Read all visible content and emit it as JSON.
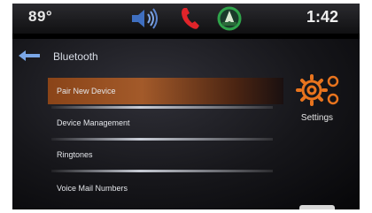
{
  "status": {
    "temperature": "89°",
    "time": "1:42"
  },
  "icons": {
    "audio": "speaker-icon",
    "phone": "phone-icon",
    "nav": "navigation-icon",
    "back": "back-arrow-icon",
    "settings": "gear-icon"
  },
  "header": {
    "title": "Bluetooth"
  },
  "menu": [
    {
      "label": "Pair New Device"
    },
    {
      "label": "Device Management"
    },
    {
      "label": "Ringtones"
    },
    {
      "label": "Voice Mail Numbers"
    }
  ],
  "settings": {
    "label": "Settings"
  },
  "colors": {
    "accent": "#e8741e",
    "selected_row": "#8a4418",
    "phone": "#e0242a",
    "audio": "#4a78c8",
    "nav": "#2fa34a"
  }
}
